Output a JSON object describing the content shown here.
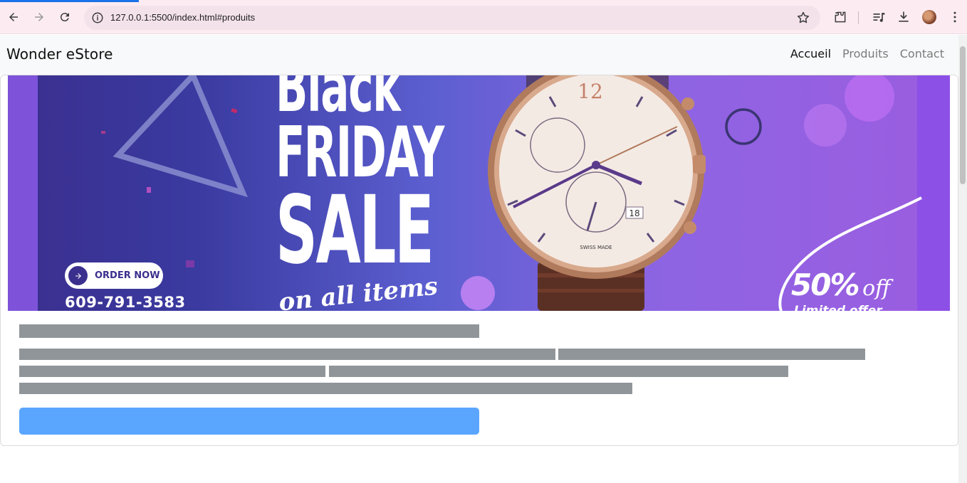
{
  "browser": {
    "url": "127.0.0.1:5500/index.html#produits"
  },
  "navbar": {
    "brand": "Wonder eStore",
    "links": [
      {
        "label": "Accueil",
        "active": true
      },
      {
        "label": "Produits",
        "active": false
      },
      {
        "label": "Contact",
        "active": false
      }
    ]
  },
  "banner": {
    "headline_line1": "Black",
    "headline_line2": "FRIDAY",
    "headline_line3": "SALE",
    "tagline": "on all items",
    "order_button": "ORDER NOW",
    "phone": "609-791-3583",
    "discount_value": "50%",
    "discount_suffix": "off",
    "limited_offer": "Limited offer",
    "watch_brand_text": "SWISS MADE",
    "watch_date": "18",
    "watch_hour": "12"
  },
  "colors": {
    "accent_button": "#5aa6ff",
    "skeleton": "#909599",
    "banner_purple": "#8e64e3"
  }
}
